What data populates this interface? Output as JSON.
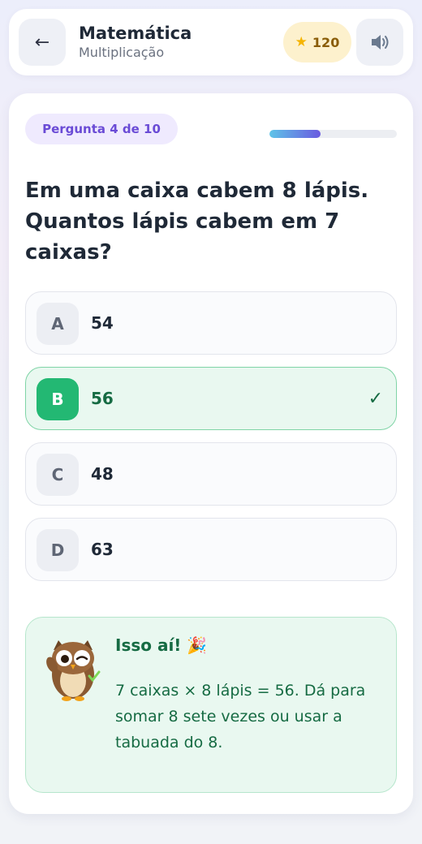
{
  "header": {
    "back_icon": "arrow-left-icon",
    "title": "Matemática",
    "subtitle": "Multiplicação",
    "score_icon": "star-icon",
    "score": "120",
    "sound_icon": "speaker-icon"
  },
  "quiz": {
    "question_counter": "Pergunta 4 de 10",
    "progress_fraction": 0.4,
    "question": "Em uma caixa cabem 8 lápis. Quantos lápis cabem em 7 caixas?",
    "options": [
      {
        "letter": "A",
        "value": "54",
        "state": "default"
      },
      {
        "letter": "B",
        "value": "56",
        "state": "correct"
      },
      {
        "letter": "C",
        "value": "48",
        "state": "default"
      },
      {
        "letter": "D",
        "value": "63",
        "state": "default"
      }
    ],
    "correct_check": "✓"
  },
  "feedback": {
    "mascot": "owl-icon",
    "title": "Isso aí!",
    "title_emoji": "🎉",
    "text": "7 caixas × 8 lápis = 56. Dá para somar 8 sete vezes ou usar a tabuada do 8."
  },
  "colors": {
    "accent": "#6a4bd6",
    "correct": "#23b873",
    "feedback_bg": "#e9f8f0",
    "score_bg": "#fdf1cd"
  }
}
